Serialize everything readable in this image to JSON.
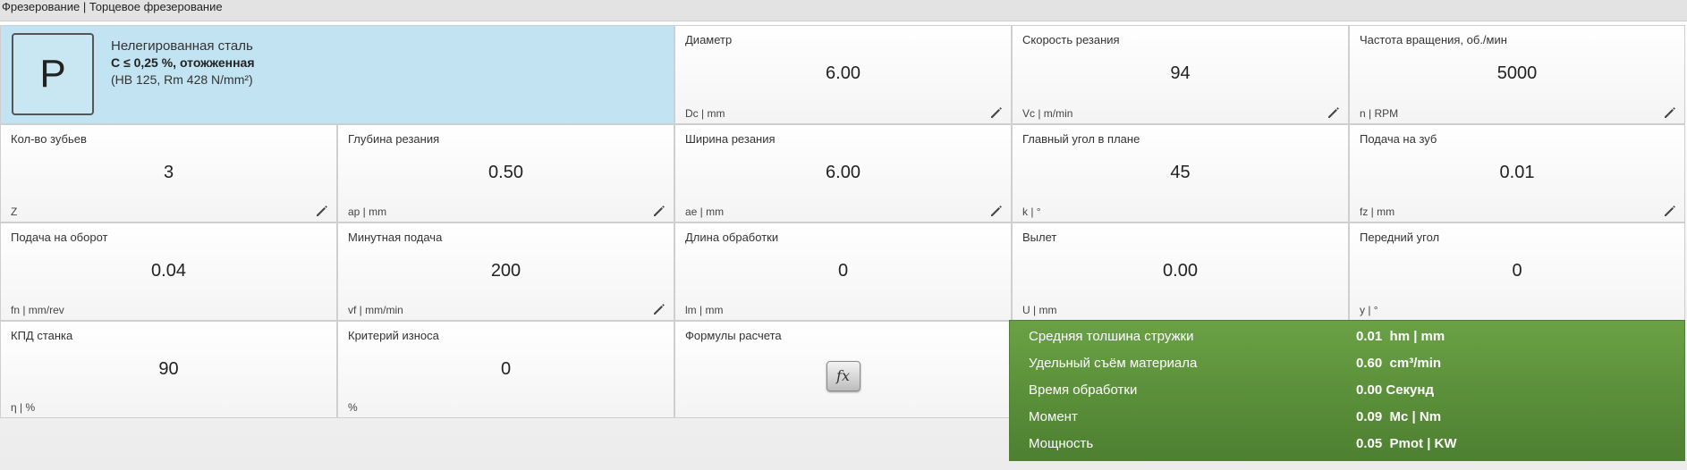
{
  "window": {
    "title": "Фрезерование | Торцевое фрезерование"
  },
  "material": {
    "group": "P",
    "name": "Нелегированная сталь",
    "condition": "C ≤ 0,25 %, отожженная",
    "hardness": "(HB 125, Rm 428 N/mm²)",
    "color": "#c2e3f1"
  },
  "params": [
    {
      "label": "Диаметр",
      "value": "6.00",
      "unit": "Dc | mm",
      "editable": true
    },
    {
      "label": "Скорость резания",
      "value": "94",
      "unit": "Vc | m/min",
      "editable": true
    },
    {
      "label": "Частота вращения, об./мин",
      "value": "5000",
      "unit": "n | RPM",
      "editable": true
    },
    {
      "label": "Кол-во зубьев",
      "value": "3",
      "unit": "Z",
      "editable": true
    },
    {
      "label": "Глубина резания",
      "value": "0.50",
      "unit": "ap | mm",
      "editable": true
    },
    {
      "label": "Ширина резания",
      "value": "6.00",
      "unit": "ae | mm",
      "editable": true
    },
    {
      "label": "Главный угол в плане",
      "value": "45",
      "unit": "k | °",
      "editable": false
    },
    {
      "label": "Подача на зуб",
      "value": "0.01",
      "unit": "fz | mm",
      "editable": true
    },
    {
      "label": "Подача на оборот",
      "value": "0.04",
      "unit": "fn | mm/rev",
      "editable": false
    },
    {
      "label": "Минутная подача",
      "value": "200",
      "unit": "vf | mm/min",
      "editable": true
    },
    {
      "label": "Длина обработки",
      "value": "0",
      "unit": "lm | mm",
      "editable": false
    },
    {
      "label": "Вылет",
      "value": "0.00",
      "unit": "U | mm",
      "editable": false
    },
    {
      "label": "Передний угол",
      "value": "0",
      "unit": "y | °",
      "editable": false
    },
    {
      "label": "КПД станка",
      "value": "90",
      "unit": "η | %",
      "editable": false
    },
    {
      "label": "Критерий износа",
      "value": "0",
      "unit": "%",
      "editable": false
    }
  ],
  "formulas": {
    "label": "Формулы расчета",
    "button": "fx"
  },
  "results": {
    "color": "#5a9239",
    "rows": [
      {
        "label": "Средняя толшина стружки",
        "value": "0.01  hm | mm"
      },
      {
        "label": "Удельный съём материала",
        "value": "0.60  cm³/min"
      },
      {
        "label": "Время обработки",
        "value": "0.00 Секунд"
      },
      {
        "label": "Момент",
        "value": "0.09  Mc | Nm"
      },
      {
        "label": "Мощность",
        "value": "0.05  Pmot | KW"
      }
    ]
  },
  "icons": {
    "edit": "pencil-icon"
  }
}
